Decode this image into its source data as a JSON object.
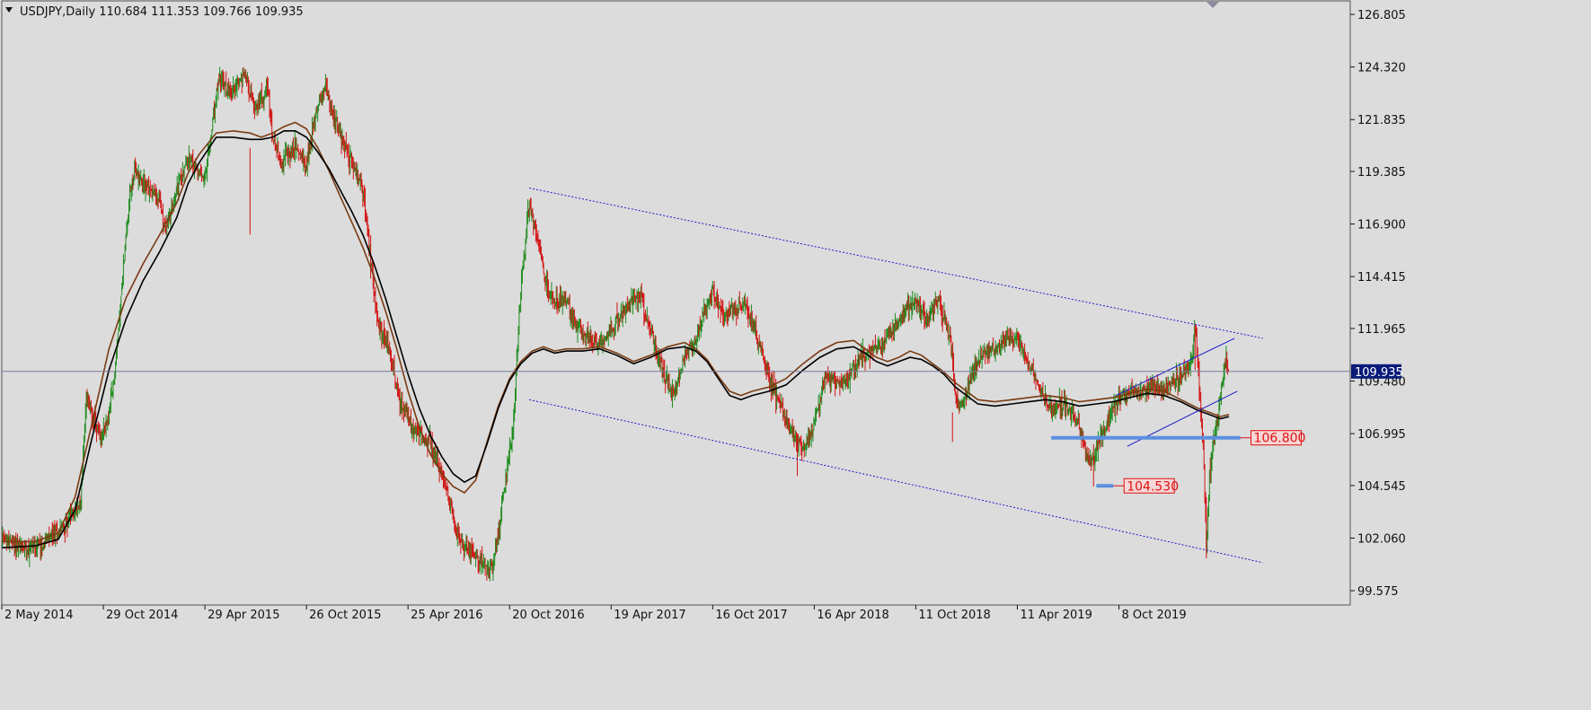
{
  "header": {
    "symbol_timeframe": "USDJPY,Daily",
    "ohlc": "110.684 111.353 109.766 109.935"
  },
  "colors": {
    "background": "#dcdcdc",
    "axis": "#000000",
    "bull_candle": "#1e8c1e",
    "bear_candle": "#d21414",
    "ma_fast": "#7a3b12",
    "ma_slow": "#000000",
    "trendline": "#1a1acc",
    "level_line": "#5b8fe0",
    "level_label": "#e01010",
    "price_tag_bg": "#0a1a7a"
  },
  "chart_data": {
    "type": "candlestick",
    "symbol": "USDJPY",
    "timeframe": "Daily",
    "last_bar": {
      "open": 110.684,
      "high": 111.353,
      "low": 109.766,
      "close": 109.935
    },
    "y_ticks": [
      126.805,
      124.32,
      121.835,
      119.385,
      116.9,
      114.415,
      111.965,
      109.48,
      106.995,
      104.545,
      102.06,
      99.575
    ],
    "y_tick_labels": [
      "126.805",
      "124.320",
      "121.835",
      "119.385",
      "116.900",
      "114.415",
      "111.965",
      "109.480",
      "106.995",
      "104.545",
      "102.060",
      "99.575"
    ],
    "ylim": [
      98.9,
      127.4
    ],
    "x_tick_labels": [
      "2 May 2014",
      "29 Oct 2014",
      "29 Apr 2015",
      "26 Oct 2015",
      "25 Apr 2016",
      "20 Oct 2016",
      "19 Apr 2017",
      "16 Oct 2017",
      "16 Apr 2018",
      "11 Oct 2018",
      "11 Apr 2019",
      "8 Oct 2019"
    ],
    "x_ticks": [
      0,
      180,
      360,
      540,
      720,
      900,
      1080,
      1260,
      1440,
      1620,
      1800,
      1980
    ],
    "xlim": [
      0,
      2390
    ],
    "price_path": [
      [
        0,
        102.0
      ],
      [
        40,
        101.6
      ],
      [
        80,
        101.9
      ],
      [
        110,
        102.6
      ],
      [
        140,
        103.8
      ],
      [
        150,
        108.8
      ],
      [
        175,
        106.7
      ],
      [
        190,
        107.8
      ],
      [
        200,
        109.8
      ],
      [
        210,
        113.0
      ],
      [
        225,
        118.0
      ],
      [
        235,
        119.4
      ],
      [
        260,
        118.6
      ],
      [
        280,
        118.0
      ],
      [
        290,
        116.5
      ],
      [
        310,
        118.5
      ],
      [
        330,
        120.0
      ],
      [
        345,
        119.5
      ],
      [
        360,
        119.0
      ],
      [
        385,
        123.8
      ],
      [
        405,
        123.0
      ],
      [
        430,
        124.1
      ],
      [
        450,
        122.2
      ],
      [
        470,
        123.6
      ],
      [
        480,
        120.8
      ],
      [
        495,
        119.8
      ],
      [
        520,
        120.5
      ],
      [
        540,
        119.8
      ],
      [
        560,
        122.6
      ],
      [
        575,
        123.3
      ],
      [
        590,
        121.8
      ],
      [
        615,
        120.1
      ],
      [
        640,
        118.5
      ],
      [
        665,
        112.5
      ],
      [
        690,
        110.5
      ],
      [
        705,
        108.5
      ],
      [
        730,
        107.2
      ],
      [
        760,
        106.5
      ],
      [
        790,
        104.2
      ],
      [
        810,
        102.0
      ],
      [
        830,
        101.5
      ],
      [
        850,
        101.0
      ],
      [
        870,
        100.6
      ],
      [
        880,
        102.2
      ],
      [
        890,
        104.4
      ],
      [
        905,
        107.0
      ],
      [
        920,
        113.8
      ],
      [
        935,
        117.9
      ],
      [
        950,
        116.0
      ],
      [
        965,
        114.0
      ],
      [
        980,
        113.2
      ],
      [
        1000,
        113.3
      ],
      [
        1020,
        112.0
      ],
      [
        1040,
        111.5
      ],
      [
        1060,
        111.2
      ],
      [
        1080,
        112.0
      ],
      [
        1100,
        112.6
      ],
      [
        1115,
        113.2
      ],
      [
        1130,
        113.5
      ],
      [
        1150,
        112.0
      ],
      [
        1170,
        110.0
      ],
      [
        1190,
        108.8
      ],
      [
        1210,
        110.5
      ],
      [
        1230,
        111.5
      ],
      [
        1245,
        112.8
      ],
      [
        1260,
        113.6
      ],
      [
        1280,
        112.6
      ],
      [
        1300,
        113.0
      ],
      [
        1320,
        113.0
      ],
      [
        1340,
        111.5
      ],
      [
        1360,
        109.6
      ],
      [
        1380,
        108.4
      ],
      [
        1400,
        107.0
      ],
      [
        1410,
        106.6
      ],
      [
        1420,
        106.3
      ],
      [
        1440,
        107.4
      ],
      [
        1460,
        109.8
      ],
      [
        1480,
        109.4
      ],
      [
        1500,
        109.5
      ],
      [
        1520,
        110.5
      ],
      [
        1540,
        111.0
      ],
      [
        1560,
        111.2
      ],
      [
        1580,
        111.9
      ],
      [
        1600,
        112.8
      ],
      [
        1620,
        113.2
      ],
      [
        1640,
        112.4
      ],
      [
        1660,
        113.4
      ],
      [
        1680,
        111.6
      ],
      [
        1690,
        109.0
      ],
      [
        1700,
        108.2
      ],
      [
        1720,
        109.8
      ],
      [
        1740,
        110.8
      ],
      [
        1760,
        110.9
      ],
      [
        1780,
        111.5
      ],
      [
        1800,
        111.4
      ],
      [
        1820,
        110.3
      ],
      [
        1840,
        109.2
      ],
      [
        1860,
        108.0
      ],
      [
        1880,
        108.4
      ],
      [
        1900,
        107.9
      ],
      [
        1910,
        107.3
      ],
      [
        1920,
        106.2
      ],
      [
        1935,
        105.8
      ],
      [
        1950,
        106.8
      ],
      [
        1965,
        108.0
      ],
      [
        1980,
        108.7
      ],
      [
        2000,
        109.0
      ],
      [
        2020,
        108.9
      ],
      [
        2040,
        109.3
      ],
      [
        2060,
        109.1
      ],
      [
        2080,
        109.4
      ],
      [
        2100,
        109.8
      ],
      [
        2110,
        110.6
      ],
      [
        2115,
        112.1
      ],
      [
        2120,
        110.4
      ],
      [
        2125,
        107.8
      ],
      [
        2130,
        106.0
      ],
      [
        2135,
        101.3
      ],
      [
        2140,
        104.8
      ],
      [
        2148,
        106.8
      ],
      [
        2155,
        107.8
      ],
      [
        2160,
        108.6
      ],
      [
        2165,
        109.6
      ],
      [
        2170,
        110.6
      ],
      [
        2175,
        109.935
      ]
    ],
    "moving_averages": [
      {
        "name": "MA (fast)",
        "points": [
          [
            0,
            101.9
          ],
          [
            60,
            101.9
          ],
          [
            100,
            102.3
          ],
          [
            130,
            104.0
          ],
          [
            160,
            107.5
          ],
          [
            190,
            111.0
          ],
          [
            220,
            113.4
          ],
          [
            250,
            115.0
          ],
          [
            280,
            116.4
          ],
          [
            310,
            117.9
          ],
          [
            330,
            119.3
          ],
          [
            350,
            120.2
          ],
          [
            380,
            121.2
          ],
          [
            410,
            121.3
          ],
          [
            440,
            121.2
          ],
          [
            460,
            121.0
          ],
          [
            480,
            121.2
          ],
          [
            500,
            121.5
          ],
          [
            520,
            121.7
          ],
          [
            540,
            121.4
          ],
          [
            560,
            120.5
          ],
          [
            580,
            119.4
          ],
          [
            600,
            118.2
          ],
          [
            620,
            117.0
          ],
          [
            640,
            115.8
          ],
          [
            660,
            114.4
          ],
          [
            680,
            112.8
          ],
          [
            700,
            111.0
          ],
          [
            720,
            109.0
          ],
          [
            740,
            107.3
          ],
          [
            760,
            106.0
          ],
          [
            780,
            105.1
          ],
          [
            800,
            104.5
          ],
          [
            820,
            104.2
          ],
          [
            840,
            104.8
          ],
          [
            860,
            106.6
          ],
          [
            880,
            108.3
          ],
          [
            900,
            109.6
          ],
          [
            920,
            110.4
          ],
          [
            940,
            110.9
          ],
          [
            960,
            111.1
          ],
          [
            980,
            110.9
          ],
          [
            1000,
            111.0
          ],
          [
            1030,
            111.0
          ],
          [
            1060,
            111.1
          ],
          [
            1090,
            110.8
          ],
          [
            1120,
            110.4
          ],
          [
            1150,
            110.7
          ],
          [
            1180,
            111.1
          ],
          [
            1210,
            111.3
          ],
          [
            1230,
            111.0
          ],
          [
            1250,
            110.5
          ],
          [
            1270,
            109.7
          ],
          [
            1290,
            109.0
          ],
          [
            1310,
            108.8
          ],
          [
            1330,
            109.0
          ],
          [
            1360,
            109.2
          ],
          [
            1390,
            109.6
          ],
          [
            1420,
            110.3
          ],
          [
            1450,
            110.9
          ],
          [
            1480,
            111.3
          ],
          [
            1510,
            111.4
          ],
          [
            1530,
            111.0
          ],
          [
            1550,
            110.6
          ],
          [
            1570,
            110.4
          ],
          [
            1590,
            110.6
          ],
          [
            1610,
            110.9
          ],
          [
            1630,
            110.7
          ],
          [
            1650,
            110.3
          ],
          [
            1670,
            109.9
          ],
          [
            1690,
            109.4
          ],
          [
            1710,
            109.0
          ],
          [
            1730,
            108.6
          ],
          [
            1760,
            108.5
          ],
          [
            1790,
            108.6
          ],
          [
            1820,
            108.7
          ],
          [
            1850,
            108.8
          ],
          [
            1880,
            108.7
          ],
          [
            1910,
            108.5
          ],
          [
            1940,
            108.6
          ],
          [
            1970,
            108.7
          ],
          [
            2000,
            108.9
          ],
          [
            2030,
            109.1
          ],
          [
            2060,
            109.0
          ],
          [
            2090,
            108.6
          ],
          [
            2120,
            108.2
          ],
          [
            2140,
            108.0
          ],
          [
            2160,
            107.8
          ],
          [
            2175,
            107.9
          ]
        ]
      },
      {
        "name": "MA (slow)",
        "points": [
          [
            0,
            101.6
          ],
          [
            60,
            101.7
          ],
          [
            100,
            102.0
          ],
          [
            130,
            103.4
          ],
          [
            160,
            106.8
          ],
          [
            190,
            110.0
          ],
          [
            220,
            112.4
          ],
          [
            250,
            114.2
          ],
          [
            280,
            115.6
          ],
          [
            310,
            117.2
          ],
          [
            330,
            118.8
          ],
          [
            350,
            119.8
          ],
          [
            380,
            121.0
          ],
          [
            410,
            121.0
          ],
          [
            440,
            120.9
          ],
          [
            460,
            120.9
          ],
          [
            480,
            121.0
          ],
          [
            500,
            121.3
          ],
          [
            520,
            121.3
          ],
          [
            540,
            121.0
          ],
          [
            560,
            120.3
          ],
          [
            580,
            119.5
          ],
          [
            600,
            118.5
          ],
          [
            620,
            117.5
          ],
          [
            640,
            116.4
          ],
          [
            660,
            115.0
          ],
          [
            680,
            113.4
          ],
          [
            700,
            111.6
          ],
          [
            720,
            109.8
          ],
          [
            740,
            108.2
          ],
          [
            760,
            106.9
          ],
          [
            780,
            105.9
          ],
          [
            800,
            105.1
          ],
          [
            820,
            104.7
          ],
          [
            840,
            105.0
          ],
          [
            860,
            106.5
          ],
          [
            880,
            108.2
          ],
          [
            900,
            109.5
          ],
          [
            920,
            110.3
          ],
          [
            940,
            110.8
          ],
          [
            960,
            111.0
          ],
          [
            980,
            110.8
          ],
          [
            1000,
            110.9
          ],
          [
            1030,
            110.9
          ],
          [
            1060,
            111.0
          ],
          [
            1090,
            110.7
          ],
          [
            1120,
            110.3
          ],
          [
            1150,
            110.6
          ],
          [
            1180,
            111.0
          ],
          [
            1210,
            111.1
          ],
          [
            1230,
            110.9
          ],
          [
            1250,
            110.4
          ],
          [
            1270,
            109.6
          ],
          [
            1290,
            108.8
          ],
          [
            1310,
            108.6
          ],
          [
            1330,
            108.8
          ],
          [
            1360,
            109.0
          ],
          [
            1390,
            109.3
          ],
          [
            1420,
            110.0
          ],
          [
            1450,
            110.6
          ],
          [
            1480,
            111.0
          ],
          [
            1510,
            111.1
          ],
          [
            1530,
            110.8
          ],
          [
            1550,
            110.4
          ],
          [
            1570,
            110.2
          ],
          [
            1590,
            110.4
          ],
          [
            1610,
            110.6
          ],
          [
            1630,
            110.5
          ],
          [
            1650,
            110.2
          ],
          [
            1670,
            109.8
          ],
          [
            1690,
            109.2
          ],
          [
            1710,
            108.8
          ],
          [
            1730,
            108.4
          ],
          [
            1760,
            108.3
          ],
          [
            1790,
            108.4
          ],
          [
            1820,
            108.5
          ],
          [
            1850,
            108.6
          ],
          [
            1880,
            108.5
          ],
          [
            1910,
            108.3
          ],
          [
            1940,
            108.4
          ],
          [
            1970,
            108.5
          ],
          [
            2000,
            108.7
          ],
          [
            2030,
            108.9
          ],
          [
            2060,
            108.8
          ],
          [
            2090,
            108.5
          ],
          [
            2120,
            108.1
          ],
          [
            2140,
            107.9
          ],
          [
            2160,
            107.7
          ],
          [
            2175,
            107.8
          ]
        ]
      }
    ],
    "trendlines": [
      {
        "name": "upper-channel",
        "style": "dotted",
        "from": [
          935,
          118.6
        ],
        "to": [
          2235,
          111.5
        ]
      },
      {
        "name": "lower-channel",
        "style": "dotted",
        "from": [
          935,
          108.6
        ],
        "to": [
          2235,
          100.9
        ]
      },
      {
        "name": "rising-channel-top",
        "style": "solid",
        "from": [
          1975,
          108.8
        ],
        "to": [
          2185,
          111.5
        ]
      },
      {
        "name": "rising-channel-bottom",
        "style": "solid",
        "from": [
          1995,
          106.4
        ],
        "to": [
          2190,
          109.0
        ]
      }
    ],
    "levels": [
      {
        "value": 106.8,
        "label": "106.800",
        "from": 1860,
        "to": 2195
      },
      {
        "value": 104.53,
        "label": "104.530",
        "from": 1940,
        "to": 1970
      }
    ],
    "current_price_label": "109.935",
    "current_price": 109.935
  }
}
